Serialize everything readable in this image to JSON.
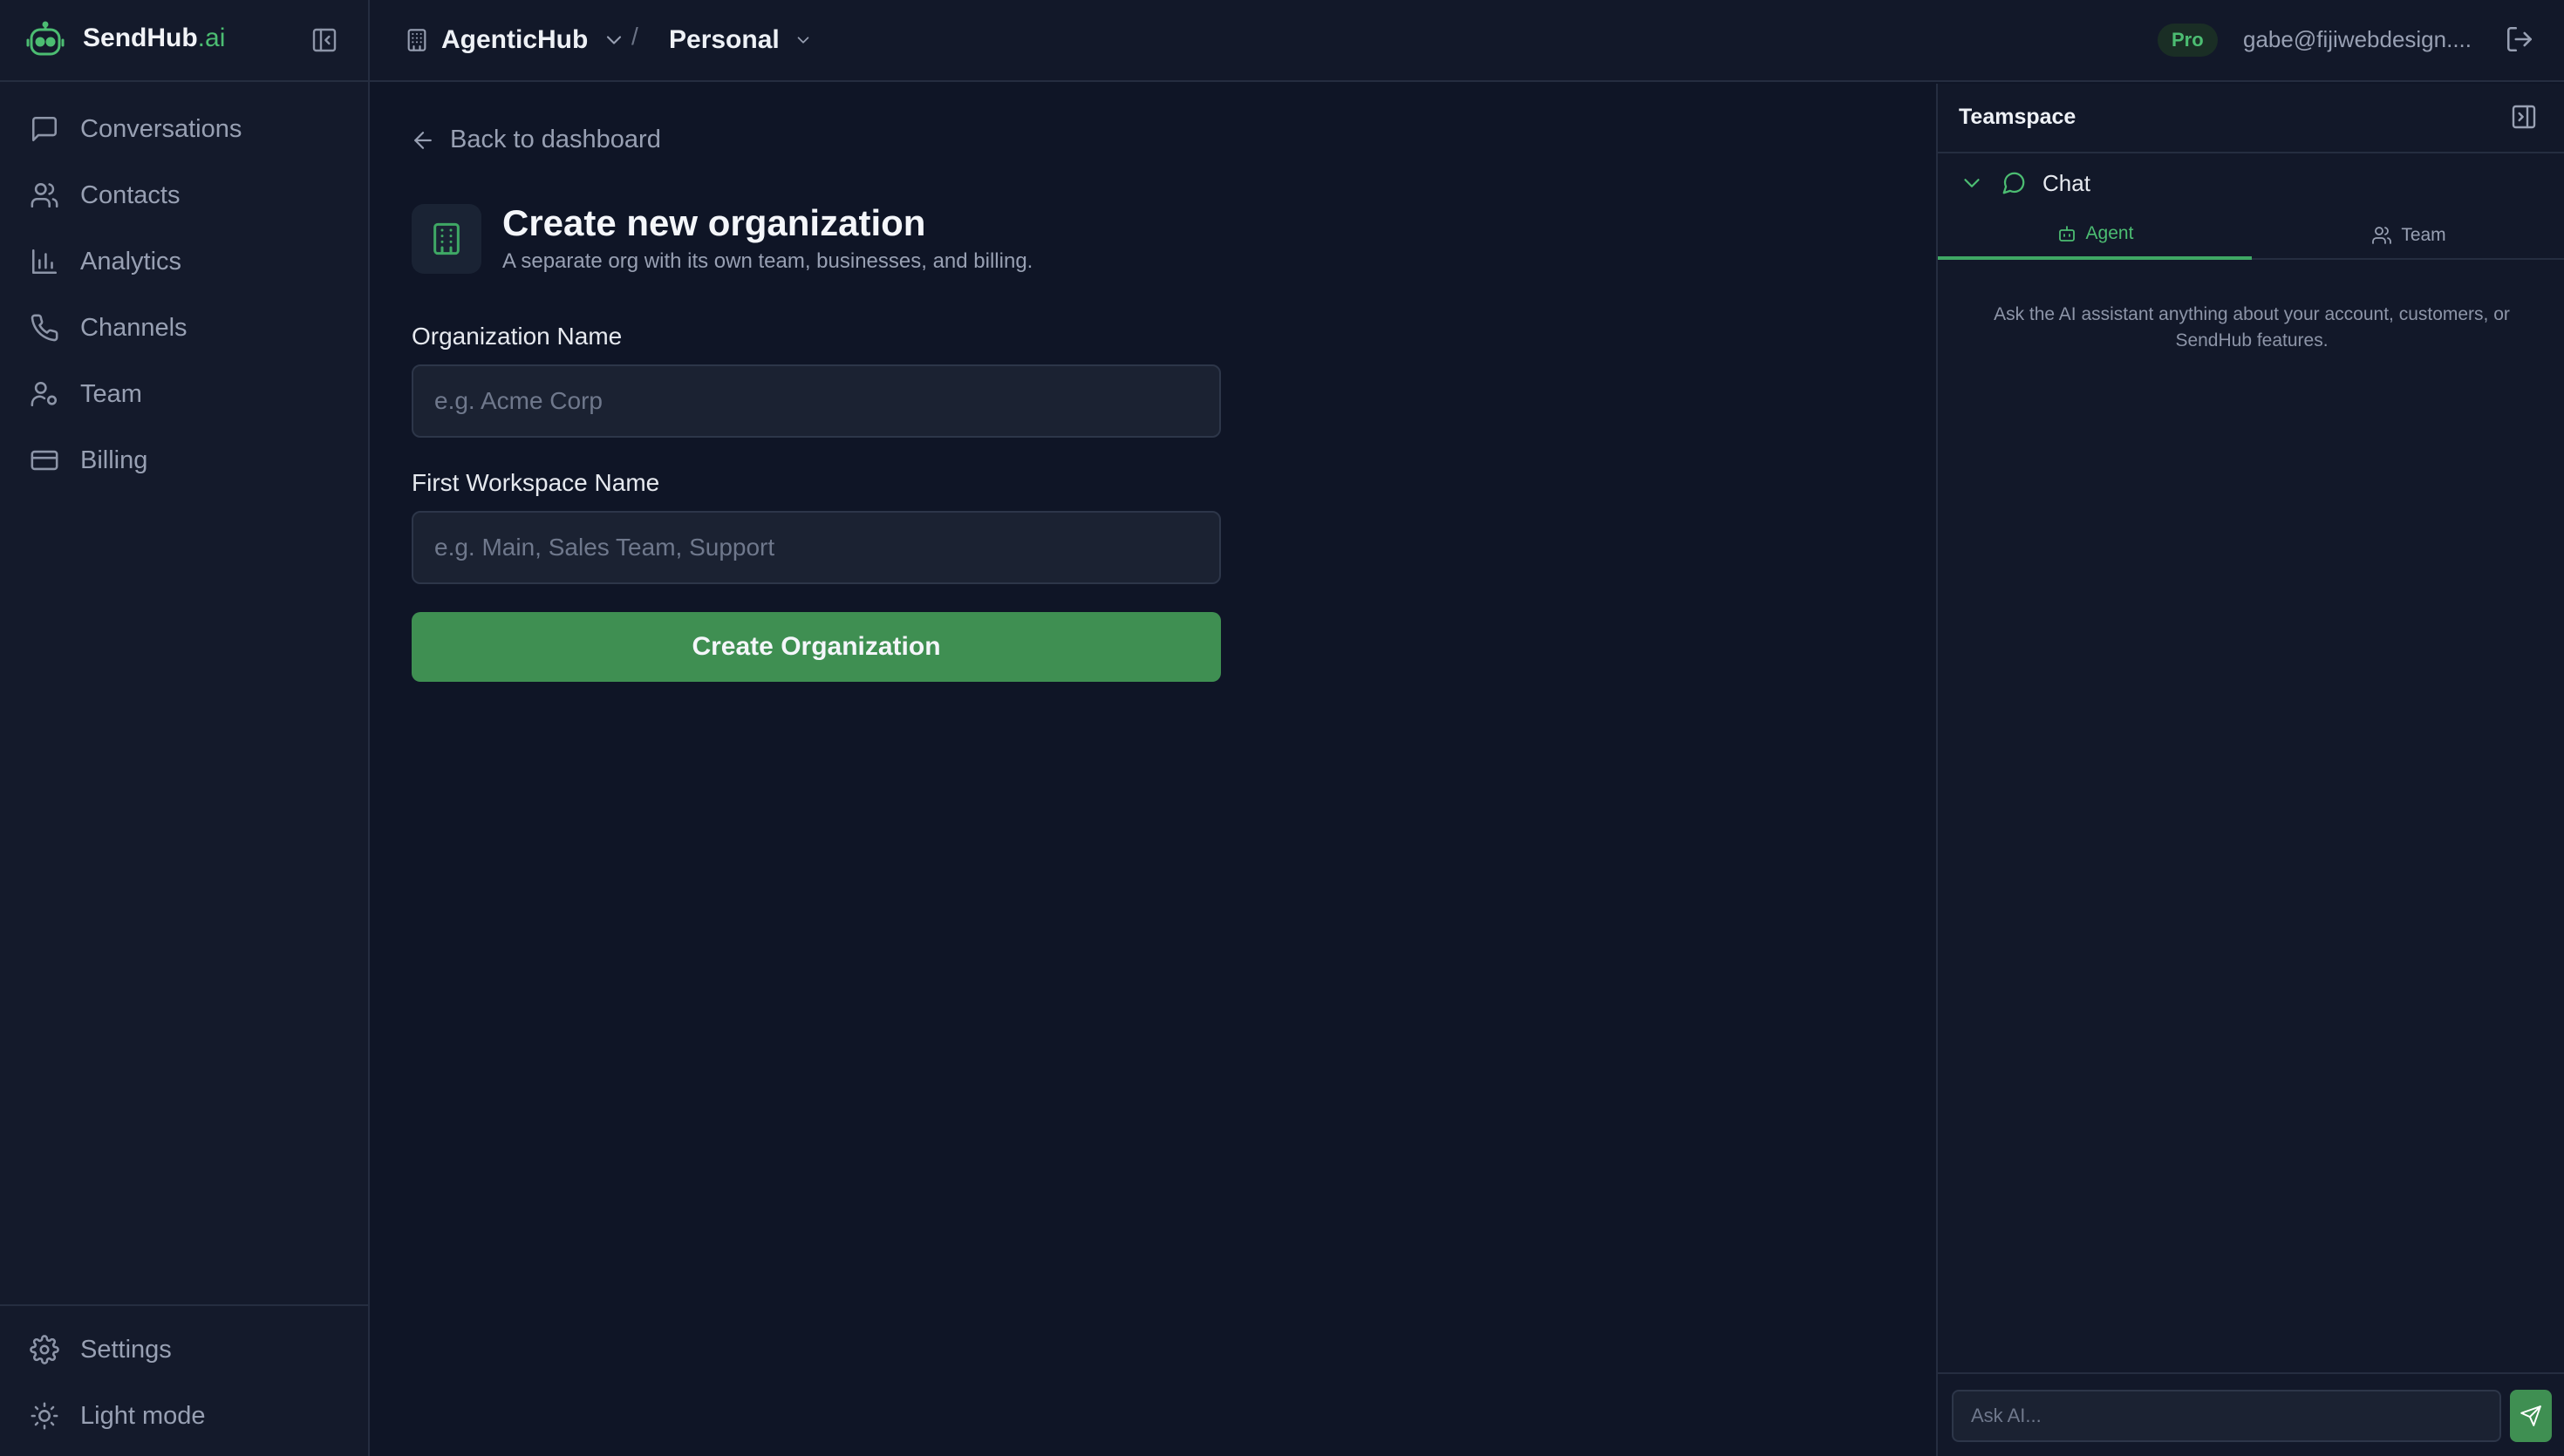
{
  "brand": {
    "name": "SendHub",
    "suffix": ".ai"
  },
  "sidebar": {
    "items": [
      {
        "label": "Conversations",
        "icon": "message-square-icon"
      },
      {
        "label": "Contacts",
        "icon": "users-icon"
      },
      {
        "label": "Analytics",
        "icon": "bar-chart-icon"
      },
      {
        "label": "Channels",
        "icon": "phone-icon"
      },
      {
        "label": "Team",
        "icon": "user-cog-icon"
      },
      {
        "label": "Billing",
        "icon": "credit-card-icon"
      }
    ],
    "bottom": [
      {
        "label": "Settings",
        "icon": "gear-icon"
      },
      {
        "label": "Light mode",
        "icon": "sun-icon"
      }
    ]
  },
  "topbar": {
    "org": "AgenticHub",
    "separator": "/",
    "workspace": "Personal",
    "plan_badge": "Pro",
    "user_email": "gabe@fijiwebdesign...."
  },
  "main": {
    "back_label": "Back to dashboard",
    "title": "Create new organization",
    "subtitle": "A separate org with its own team, businesses, and billing.",
    "org_name_label": "Organization Name",
    "org_name_placeholder": "e.g. Acme Corp",
    "workspace_label": "First Workspace Name",
    "workspace_placeholder": "e.g. Main, Sales Team, Support",
    "submit_label": "Create Organization"
  },
  "panel": {
    "title": "Teamspace",
    "chat_label": "Chat",
    "tabs": [
      {
        "label": "Agent",
        "active": true
      },
      {
        "label": "Team",
        "active": false
      }
    ],
    "hint": "Ask the AI assistant anything about your account, customers, or SendHub features.",
    "input_placeholder": "Ask AI..."
  },
  "colors": {
    "accent": "#4cbd72",
    "button": "#3f8f52",
    "background": "#0f1526",
    "sidebar": "#141a2b"
  }
}
